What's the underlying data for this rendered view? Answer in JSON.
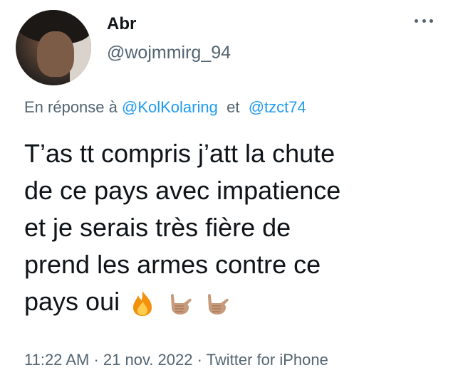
{
  "author": {
    "display_name": "Abr",
    "handle": "@wojmmirg_94"
  },
  "reply_context": {
    "prefix": "En réponse à",
    "mention_1": "@KolKolaring",
    "conjunction": "et",
    "mention_2": "@tzct74"
  },
  "tweet": {
    "line_1": "T’as tt compris j’att la chute",
    "line_2": "de ce pays avec impatience",
    "line_3": "et je serais très fière de",
    "line_4": "prend les armes contre ce",
    "line_5": "pays oui",
    "emojis": [
      "fire-emoji",
      "call-me-hand-emoji",
      "call-me-hand-emoji"
    ]
  },
  "meta": {
    "time": "11:22 AM",
    "date": "21 nov. 2022",
    "source": "Twitter for iPhone",
    "separator": "·"
  },
  "colors": {
    "text": "#0f1419",
    "secondary": "#536471",
    "link": "#1d9bf0"
  }
}
